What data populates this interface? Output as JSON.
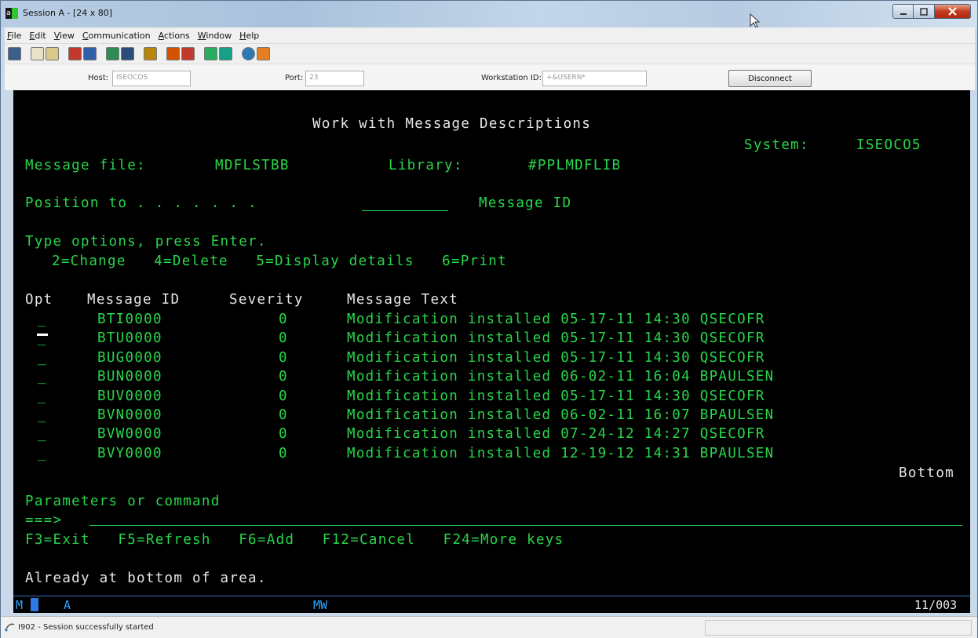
{
  "window": {
    "title": "Session A - [24 x 80]",
    "app_icon_letter": "a"
  },
  "menu": [
    {
      "label": "File",
      "underline": "F",
      "rest": "ile"
    },
    {
      "label": "Edit",
      "underline": "E",
      "rest": "dit"
    },
    {
      "label": "View",
      "underline": "V",
      "rest": "iew"
    },
    {
      "label": "Communication",
      "underline": "C",
      "rest": "ommunication"
    },
    {
      "label": "Actions",
      "underline": "A",
      "rest": "ctions"
    },
    {
      "label": "Window",
      "underline": "W",
      "rest": "indow"
    },
    {
      "label": "Help",
      "underline": "H",
      "rest": "elp"
    }
  ],
  "connection": {
    "host_label": "Host:",
    "host_value": "ISEOCOS",
    "port_label": "Port:",
    "port_value": "23",
    "workstation_label": "Workstation ID:",
    "workstation_value": "+&USERN*",
    "disconnect_label": "Disconnect"
  },
  "terminal": {
    "title": "Work with Message Descriptions",
    "system_label": "System:",
    "system_value": "ISEOCO5",
    "message_file_label": "Message file:",
    "message_file_value": "MDFLSTBB",
    "library_label": "Library:",
    "library_value": "#PPLMDFLIB",
    "position_to_label": "Position to . . . . . . .",
    "position_to_suffix": "Message ID",
    "instructions": "Type options, press Enter.",
    "options": "2=Change   4=Delete   5=Display details   6=Print",
    "col_opt": "Opt",
    "col_msgid": "Message ID",
    "col_severity": "Severity",
    "col_text": "Message Text",
    "rows": [
      {
        "id": "BTI0000",
        "severity": "0",
        "text": "Modification installed 05-17-11 14:30 QSECOFR"
      },
      {
        "id": "BTU0000",
        "severity": "0",
        "text": "Modification installed 05-17-11 14:30 QSECOFR"
      },
      {
        "id": "BUG0000",
        "severity": "0",
        "text": "Modification installed 05-17-11 14:30 QSECOFR"
      },
      {
        "id": "BUN0000",
        "severity": "0",
        "text": "Modification installed 06-02-11 16:04 BPAULSEN"
      },
      {
        "id": "BUV0000",
        "severity": "0",
        "text": "Modification installed 05-17-11 14:30 QSECOFR"
      },
      {
        "id": "BVN0000",
        "severity": "0",
        "text": "Modification installed 06-02-11 16:07 BPAULSEN"
      },
      {
        "id": "BVW0000",
        "severity": "0",
        "text": "Modification installed 07-24-12 14:27 QSECOFR"
      },
      {
        "id": "BVY0000",
        "severity": "0",
        "text": "Modification installed 12-19-12 14:31 BPAULSEN"
      }
    ],
    "bottom_marker": "Bottom",
    "params_label": "Parameters or command",
    "prompt": "===>",
    "function_keys": "F3=Exit   F5=Refresh   F6=Add   F12=Cancel   F24=More keys",
    "message": "Already at bottom of area."
  },
  "oia": {
    "left": "M",
    "glyph": "A",
    "mode": "MW",
    "cursor_pos": "11/003"
  },
  "status": {
    "message": "I902 - Session successfully started"
  },
  "colors": {
    "terminal_green": "#29d64a",
    "terminal_white": "#e6e6e6",
    "oia_blue": "#29a4ff"
  }
}
